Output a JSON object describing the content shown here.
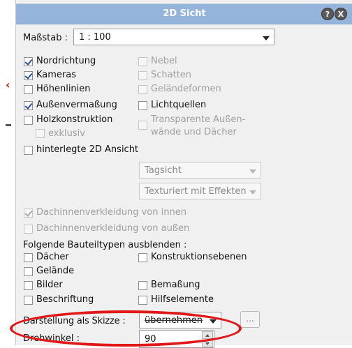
{
  "dialog": {
    "title": "2D Sicht",
    "help_glyph": "?",
    "close_glyph": "X"
  },
  "massstab": {
    "label": "Maßstab :",
    "value": "1 : 100"
  },
  "options_left": [
    {
      "label": "Nordrichtung",
      "checked": true
    },
    {
      "label": "Kameras",
      "checked": true
    },
    {
      "label": "Höhenlinien",
      "checked": false
    },
    {
      "label": "Außenvermaßung",
      "checked": true
    },
    {
      "label": "Holzkonstruktion",
      "checked": false
    },
    {
      "label": "exklusiv",
      "checked": false,
      "disabled": true
    },
    {
      "label": "hinterlegte 2D Ansicht",
      "checked": false
    }
  ],
  "options_right": [
    {
      "label": "Nebel",
      "checked": false,
      "disabled": true
    },
    {
      "label": "Schatten",
      "checked": false,
      "disabled": true
    },
    {
      "label": "Geländeformen",
      "checked": false,
      "disabled": true
    },
    {
      "label": "Lichtquellen",
      "checked": false
    },
    {
      "label_line1": "Transparente Außen-",
      "label_line2": "wände und Dächer",
      "checked": false,
      "disabled": true
    }
  ],
  "view_combo": {
    "value": "Tagsicht"
  },
  "texture_combo": {
    "value": "Texturiert mit Effekten"
  },
  "dach": [
    {
      "label": "Dachinnenverkleidung von innen",
      "checked": true,
      "disabled": true
    },
    {
      "label": "Dachinnenverkleidung von außen",
      "checked": false,
      "disabled": true
    }
  ],
  "hide_section": {
    "heading": "Folgende Bauteiltypen ausblenden :",
    "left": [
      {
        "label": "Dächer",
        "checked": false
      },
      {
        "label": "Gelände",
        "checked": false
      },
      {
        "label": "Bilder",
        "checked": false
      },
      {
        "label": "Beschriftung",
        "checked": false
      }
    ],
    "right": [
      {
        "label": "Konstruktionsebenen",
        "checked": false
      },
      {
        "label": "Bemaßung",
        "checked": false
      },
      {
        "label": "Hilfselemente",
        "checked": false
      }
    ]
  },
  "skizze": {
    "label": "Darstellung als Skizze :",
    "value": "übernehmen",
    "more_label": "..."
  },
  "drehwinkel": {
    "label": "Drehwinkel :",
    "value": "90"
  },
  "colors": {
    "titlebar": "#95b4dc",
    "annotation": "#e01818",
    "check": "#2a4f9a"
  }
}
